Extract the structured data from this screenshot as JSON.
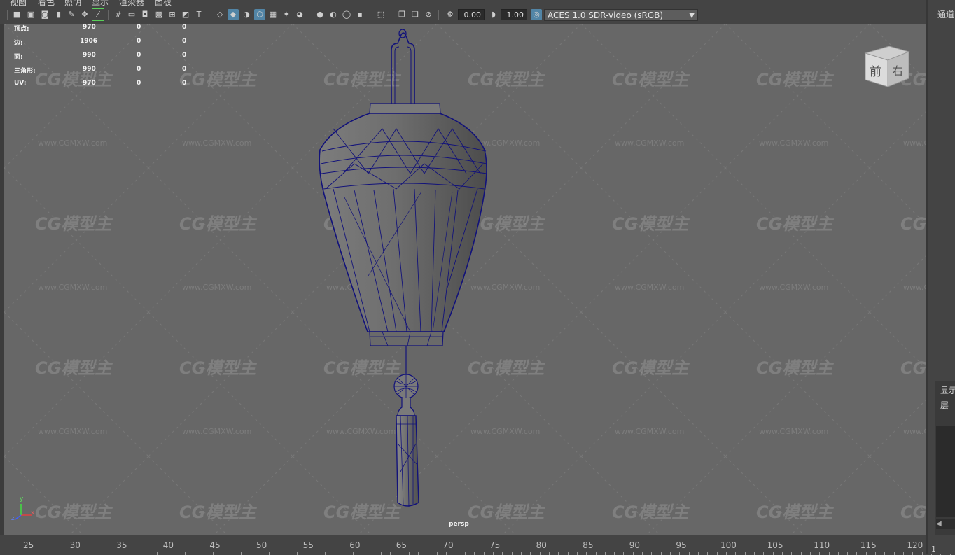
{
  "menu": [
    "视图",
    "着色",
    "照明",
    "显示",
    "渲染器",
    "面板"
  ],
  "toolbar": {
    "exposure_value": "0.00",
    "gamma_value": "1.00",
    "color_management": "ACES 1.0 SDR-video (sRGB)"
  },
  "hud": {
    "rows": [
      {
        "label": "顶点:",
        "v1": "970",
        "v2": "0",
        "v3": "0"
      },
      {
        "label": "边:",
        "v1": "1906",
        "v2": "0",
        "v3": "0"
      },
      {
        "label": "面:",
        "v1": "990",
        "v2": "0",
        "v3": "0"
      },
      {
        "label": "三角形:",
        "v1": "990",
        "v2": "0",
        "v3": "0"
      },
      {
        "label": "UV:",
        "v1": "970",
        "v2": "0",
        "v3": "0"
      }
    ]
  },
  "viewcube": {
    "front": "前",
    "right": "右"
  },
  "camera_label": "persp",
  "axis": {
    "x": "x",
    "y": "y",
    "z": "z"
  },
  "watermark": {
    "logo": "CG模型主",
    "url": "www.CGMXW.com"
  },
  "timeline": {
    "ticks": [
      "25",
      "30",
      "35",
      "40",
      "45",
      "50",
      "55",
      "60",
      "65",
      "70",
      "75",
      "80",
      "85",
      "90",
      "95",
      "100",
      "105",
      "110",
      "115",
      "120"
    ]
  },
  "right_panel": {
    "title": "通道",
    "tab_display": "显示",
    "tab_layer": "层",
    "bottom_value": "1"
  },
  "colors": {
    "viewport_bg": "#676767",
    "wireframe": "#12127a",
    "toolbar_active": "#5285a6"
  }
}
